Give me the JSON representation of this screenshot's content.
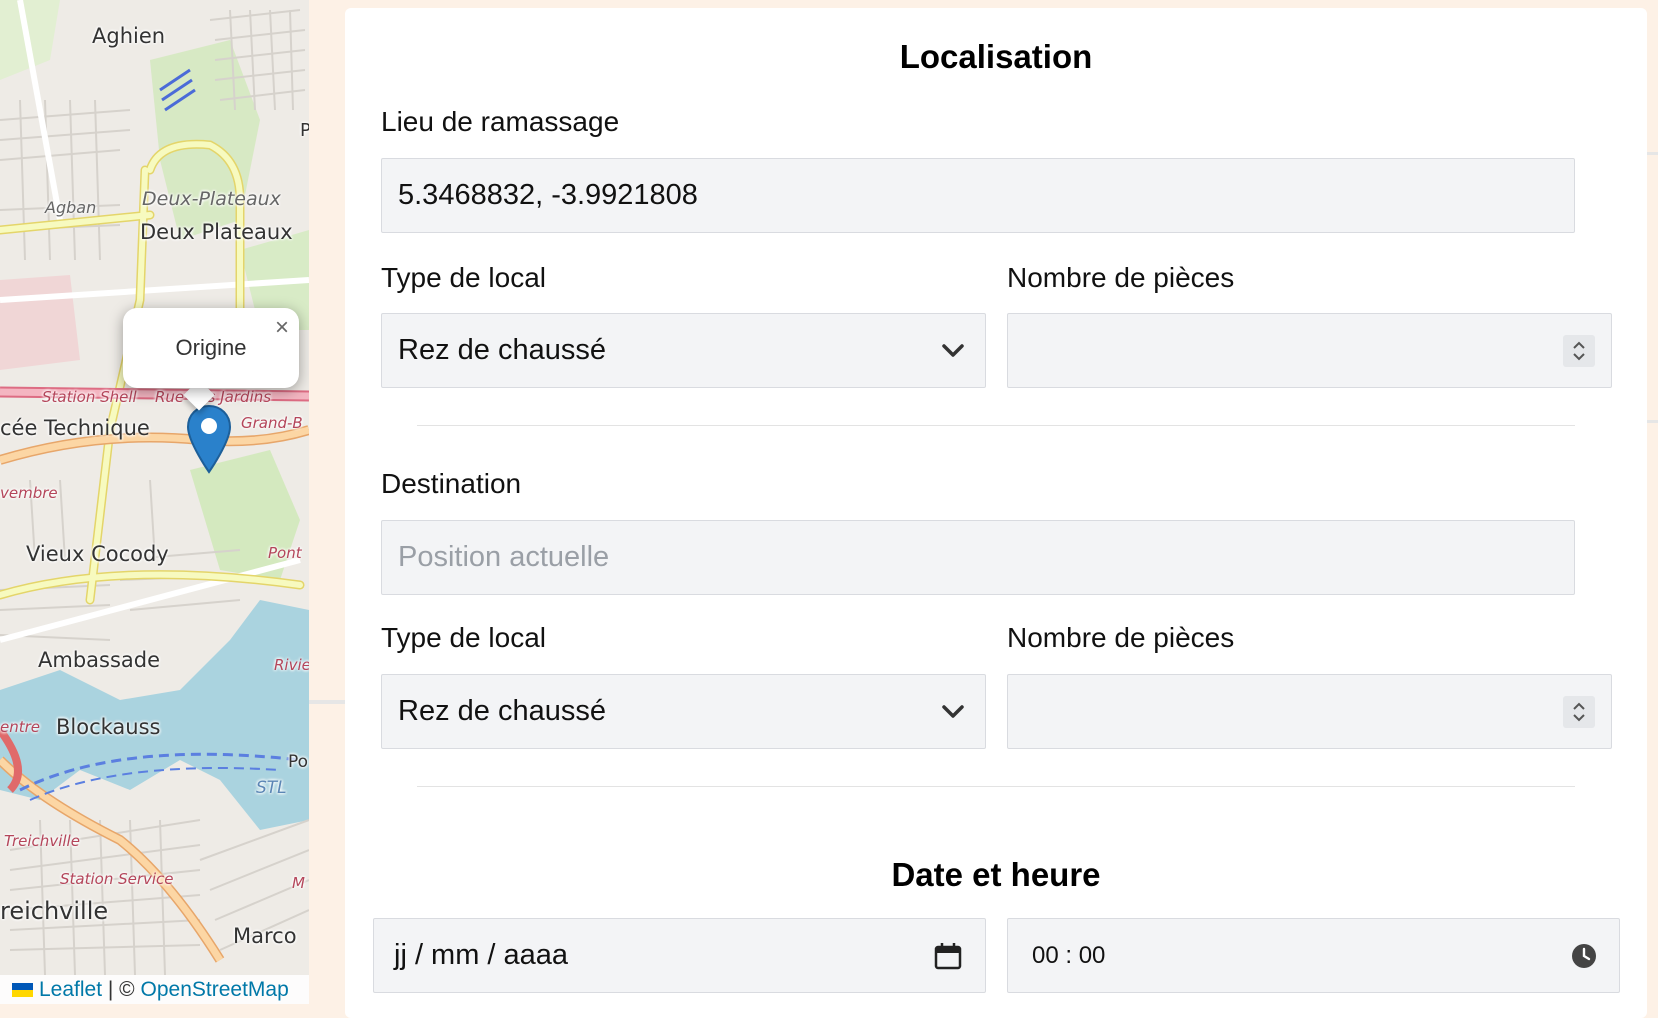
{
  "map": {
    "labels": {
      "aghien": "Aghien",
      "agban": "Agban",
      "deux_plateaux_italic": "Deux-Plateaux",
      "deux_plateaux": "Deux Plateaux",
      "station_shell": "Station Shell",
      "rue_jardins": "Rue des Jardins",
      "lycee_technique": "cée Technique",
      "grand_b": "Grand-B",
      "novembre": "vembre",
      "vieux_cocody": "Vieux Cocody",
      "pont": "Pont",
      "ambassade": "Ambassade",
      "rivie": "Rivie",
      "entre": "entre",
      "blockauss": "Blockauss",
      "po": "Po",
      "stl": "STL",
      "treichville_italic": "Treichville",
      "station_service": "Station Service",
      "treichville": "reichville",
      "marco": "Marco",
      "m": "M",
      "p": "P"
    },
    "popup": {
      "text": "Origine",
      "close": "×"
    },
    "attribution": {
      "leaflet": "Leaflet",
      "separator": " | © ",
      "osm": "OpenStreetMap"
    },
    "colors": {
      "water": "#aad3df",
      "road_major": "#f7fabf",
      "road_primary": "#fcd6a4",
      "road_motorway": "#e892a2",
      "marker": "#2a81cb"
    }
  },
  "form": {
    "localisation_title": "Localisation",
    "pickup": {
      "label": "Lieu de ramassage",
      "value": "5.3468832, -3.9921808",
      "type_label": "Type de local",
      "type_value": "Rez de chaussé",
      "rooms_label": "Nombre de pièces",
      "rooms_value": ""
    },
    "destination": {
      "label": "Destination",
      "placeholder": "Position actuelle",
      "type_label": "Type de local",
      "type_value": "Rez de chaussé",
      "rooms_label": "Nombre de pièces",
      "rooms_value": ""
    },
    "datetime_title": "Date et heure",
    "date_placeholder": "jj / mm / aaaa",
    "time_value": "00 : 00"
  }
}
